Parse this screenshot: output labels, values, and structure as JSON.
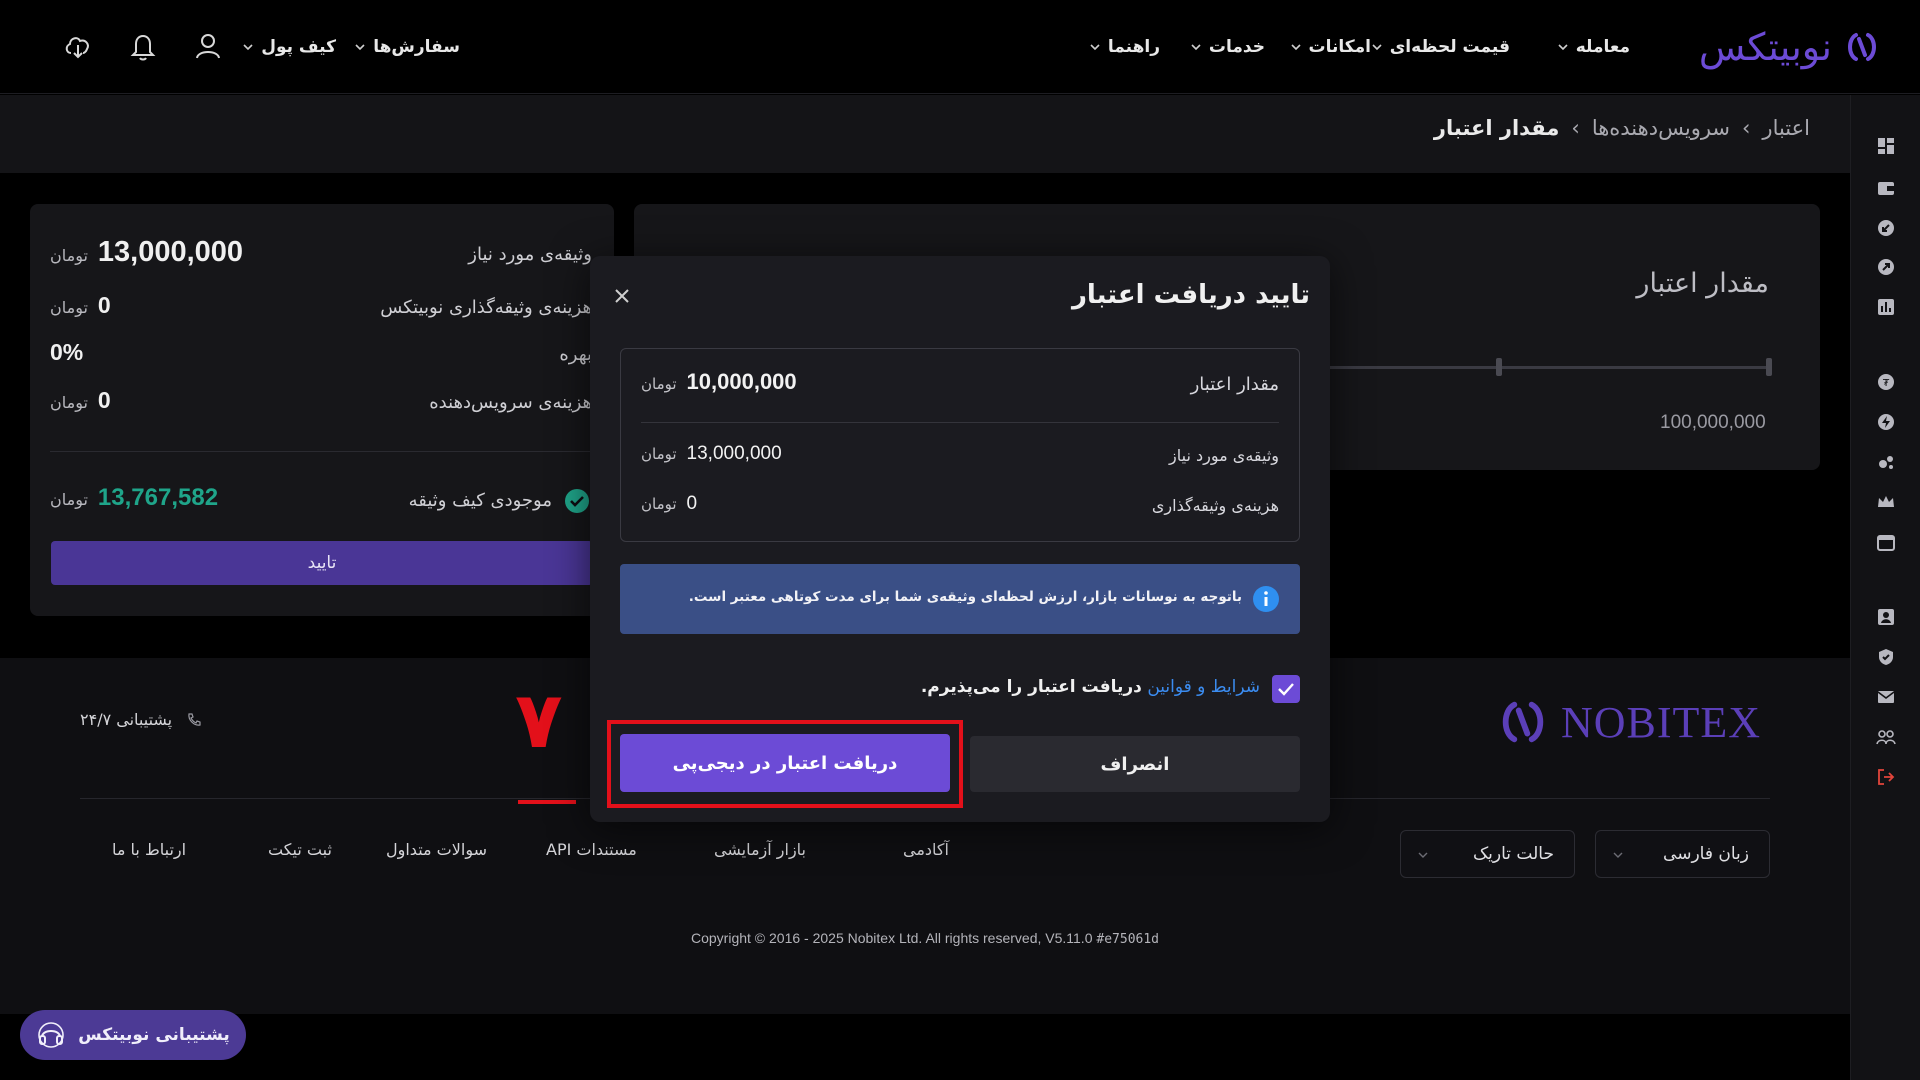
{
  "header": {
    "logo_text": "نوبیتکس",
    "nav": [
      "معامله",
      "قیمت لحظه‌ای",
      "امکانات",
      "خدمات",
      "راهنما"
    ],
    "orders_label": "سفارش‌ها",
    "wallet_label": "کیف پول"
  },
  "breadcrumb": {
    "items": [
      "اعتبار",
      "سرویس‌دهنده‌ها",
      "مقدار اعتبار"
    ]
  },
  "summary": {
    "required_collateral_label": "وثیقه‌ی مورد نیاز",
    "required_collateral_value": "13,000,000",
    "collateral_fee_label": "هزینه‌ی وثیقه‌گذاری نوبیتکس",
    "collateral_fee_value": "0",
    "interest_label": "بهره",
    "interest_value": "0%",
    "provider_fee_label": "هزینه‌ی سرویس‌دهنده",
    "provider_fee_value": "0",
    "wallet_balance_label": "موجودی کیف وثیقه",
    "wallet_balance_value": "13,767,582",
    "unit": "تومان",
    "confirm_button": "تایید"
  },
  "credit_card": {
    "title": "مقدار اعتبار",
    "slider_max_label": "100,000,000"
  },
  "modal": {
    "title": "تایید دریافت اعتبار",
    "credit_amount_label": "مقدار اعتبار",
    "credit_amount_value": "10,000,000",
    "required_collateral_label": "وثیقه‌ی مورد نیاز",
    "required_collateral_value": "13,000,000",
    "collateral_fee_label": "هزینه‌ی وثیقه‌گذاری",
    "collateral_fee_value": "0",
    "unit": "تومان",
    "notice": "باتوجه به نوسانات بازار، ارزش لحظه‌ای وثیقه‌ی شما برای مدت کوتاهی معتبر است.",
    "terms_link": "شرایط و قوانین",
    "terms_text": "دریافت اعتبار را می‌پذیرم.",
    "terms_checked": true,
    "confirm_button": "دریافت اعتبار در دیجی‌پی",
    "cancel_button": "انصراف",
    "step_annotation": "۷"
  },
  "footer": {
    "brand": "NOBITEX",
    "support_label": "پشتیبانی ۲۴/۷",
    "links": [
      "آکادمی",
      "بازار آزمایشی",
      "مستندات API",
      "سوالات متداول",
      "ثبت تیکت",
      "ارتباط با ما"
    ],
    "language_select": "زبان فارسی",
    "theme_select": "حالت تاریک",
    "copyright_prefix": "Copyright © 2016 - 2025 Nobitex Ltd. All rights reserved, V5.11.0 ",
    "copyright_hash": "#e75061d"
  },
  "support_widget": "پشتیبانی نوبیتکس",
  "colors": {
    "accent": "#6c4bd6",
    "green": "#1fa58a",
    "highlight_red": "#e3101a",
    "info_blue": "#3a4f86"
  }
}
